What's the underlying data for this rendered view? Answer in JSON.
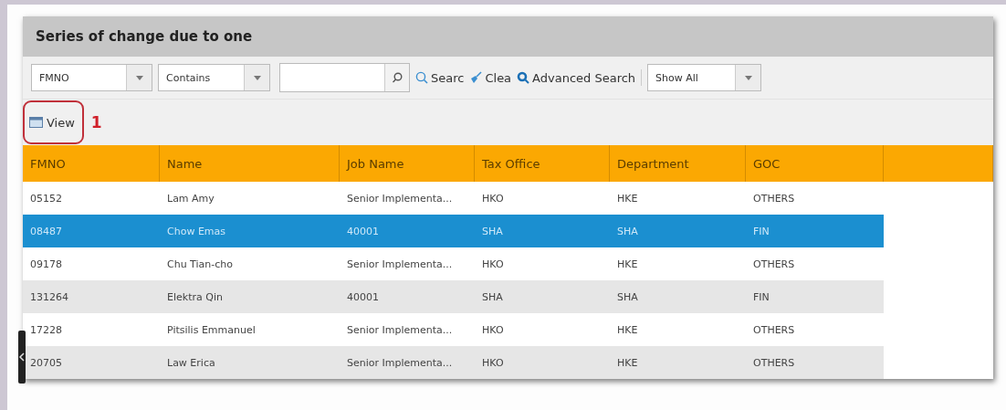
{
  "panel": {
    "title": "Series of change due to one"
  },
  "toolbar": {
    "field_filter": {
      "value": "FMNO"
    },
    "operator_filter": {
      "value": "Contains"
    },
    "buttons": [
      {
        "kind": "search",
        "label": "Searc"
      },
      {
        "kind": "clear",
        "label": "Clea"
      },
      {
        "kind": "advanced",
        "label": "Advanced Search"
      }
    ],
    "show_filter": {
      "value": "Show All"
    }
  },
  "actions": [
    {
      "label": "View",
      "highlighted": true,
      "callout": "1"
    }
  ],
  "table": {
    "columns": [
      "FMNO",
      "Name",
      "Job Name",
      "Tax Office",
      "Department",
      "GOC"
    ],
    "rows": [
      {
        "cells": [
          "05152",
          "Lam Amy",
          "Senior Implementa...",
          "HKO",
          "HKE",
          "OTHERS"
        ],
        "selected": false
      },
      {
        "cells": [
          "08487",
          "Chow Emas",
          "40001",
          "SHA",
          "SHA",
          "FIN"
        ],
        "selected": true
      },
      {
        "cells": [
          "09178",
          "Chu Tian-cho",
          "Senior Implementa...",
          "HKO",
          "HKE",
          "OTHERS"
        ],
        "selected": false
      },
      {
        "cells": [
          "131264",
          "Elektra Qin",
          "40001",
          "SHA",
          "SHA",
          "FIN"
        ],
        "selected": false
      },
      {
        "cells": [
          "17228",
          "Pitsilis Emmanuel",
          "Senior Implementa...",
          "HKO",
          "HKE",
          "OTHERS"
        ],
        "selected": false
      },
      {
        "cells": [
          "20705",
          "Law Erica",
          "Senior Implementa...",
          "HKO",
          "HKE",
          "OTHERS"
        ],
        "selected": false
      }
    ]
  }
}
